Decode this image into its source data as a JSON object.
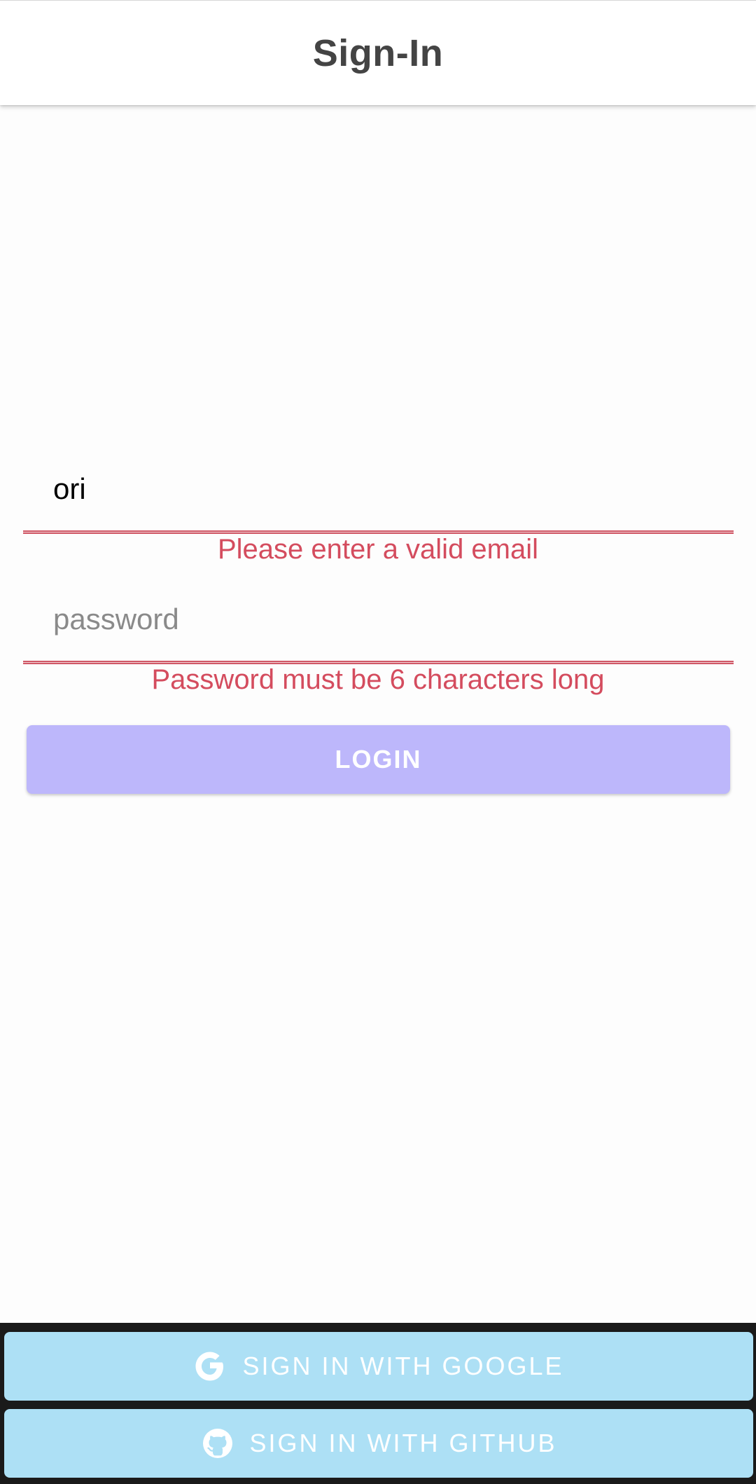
{
  "app_bar": {
    "title": "Sign-In"
  },
  "form": {
    "email": {
      "value": "ori",
      "error": "Please enter a valid email"
    },
    "password": {
      "placeholder": "password",
      "value": "",
      "error": "Password must be 6 characters long"
    },
    "login_button": {
      "label": "LOGIN"
    }
  },
  "social": {
    "google": {
      "label": "SIGN IN WITH GOOGLE",
      "icon": "google-icon"
    },
    "github": {
      "label": "SIGN IN WITH GITHUB",
      "icon": "github-icon"
    }
  },
  "colors": {
    "error": "#d44c5e",
    "login_button_bg": "#bdb7fb",
    "social_button_bg": "#ade0f5",
    "title_text": "#444444"
  }
}
